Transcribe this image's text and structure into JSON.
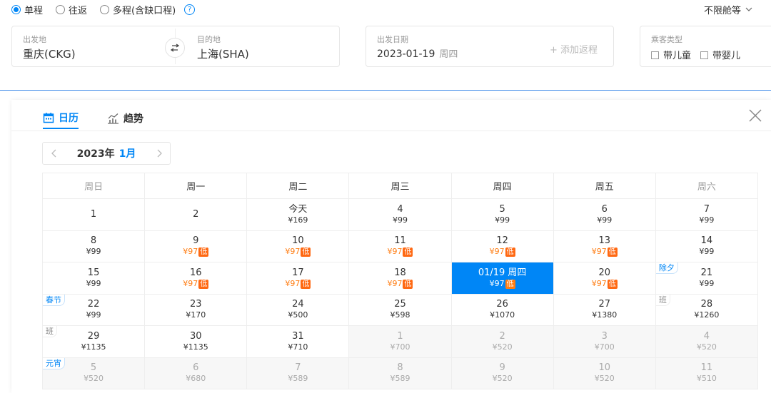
{
  "trip_types": [
    {
      "label": "单程",
      "selected": true
    },
    {
      "label": "往返",
      "selected": false
    },
    {
      "label": "多程(含缺口程)",
      "selected": false
    }
  ],
  "cabin": "不限舱等",
  "departure": {
    "label": "出发地",
    "value": "重庆(CKG)"
  },
  "arrival": {
    "label": "目的地",
    "value": "上海(SHA)"
  },
  "date": {
    "label": "出发日期",
    "value": "2023-01-19",
    "weekday": "周四",
    "add_return": "+ 添加返程"
  },
  "passengers": {
    "label": "乘客类型",
    "child": "带儿童",
    "infant": "带婴儿"
  },
  "tabs": {
    "calendar": "日历",
    "trend": "趋势"
  },
  "month_nav": {
    "year": "2023年",
    "month": "1月"
  },
  "colors": {
    "accent": "#0086f6",
    "low": "#ff6913"
  },
  "calendar": {
    "weekdays": [
      "周日",
      "周一",
      "周二",
      "周三",
      "周四",
      "周五",
      "周六"
    ],
    "weeks": [
      [
        {
          "day": "1",
          "price": ""
        },
        {
          "day": "2",
          "price": ""
        },
        {
          "day": "今天",
          "price": "¥169"
        },
        {
          "day": "4",
          "price": "¥99"
        },
        {
          "day": "5",
          "price": "¥99"
        },
        {
          "day": "6",
          "price": "¥99"
        },
        {
          "day": "7",
          "price": "¥99"
        }
      ],
      [
        {
          "day": "8",
          "price": "¥99"
        },
        {
          "day": "9",
          "price": "¥97",
          "low": "低"
        },
        {
          "day": "10",
          "price": "¥97",
          "low": "低"
        },
        {
          "day": "11",
          "price": "¥97",
          "low": "低"
        },
        {
          "day": "12",
          "price": "¥97",
          "low": "低"
        },
        {
          "day": "13",
          "price": "¥97",
          "low": "低"
        },
        {
          "day": "14",
          "price": "¥99"
        }
      ],
      [
        {
          "day": "15",
          "price": "¥99"
        },
        {
          "day": "16",
          "price": "¥97",
          "low": "低"
        },
        {
          "day": "17",
          "price": "¥97",
          "low": "低"
        },
        {
          "day": "18",
          "price": "¥97",
          "low": "低"
        },
        {
          "day": "01/19 周四",
          "price": "¥97",
          "low": "低",
          "selected": true
        },
        {
          "day": "20",
          "price": "¥97",
          "low": "低"
        },
        {
          "day": "21",
          "price": "¥99",
          "tag": "除夕"
        }
      ],
      [
        {
          "day": "22",
          "price": "¥99",
          "tag": "春节"
        },
        {
          "day": "23",
          "price": "¥170"
        },
        {
          "day": "24",
          "price": "¥500"
        },
        {
          "day": "25",
          "price": "¥598"
        },
        {
          "day": "26",
          "price": "¥1070"
        },
        {
          "day": "27",
          "price": "¥1380"
        },
        {
          "day": "28",
          "price": "¥1260",
          "tag": "班"
        }
      ],
      [
        {
          "day": "29",
          "price": "¥1135",
          "tag": "班"
        },
        {
          "day": "30",
          "price": "¥1135"
        },
        {
          "day": "31",
          "price": "¥710"
        },
        {
          "day": "1",
          "price": "¥700",
          "other": true
        },
        {
          "day": "2",
          "price": "¥520",
          "other": true
        },
        {
          "day": "3",
          "price": "¥700",
          "other": true
        },
        {
          "day": "4",
          "price": "¥520",
          "other": true
        }
      ],
      [
        {
          "day": "5",
          "price": "¥520",
          "tag": "元宵",
          "other": true
        },
        {
          "day": "6",
          "price": "¥680",
          "other": true
        },
        {
          "day": "7",
          "price": "¥589",
          "other": true
        },
        {
          "day": "8",
          "price": "¥589",
          "other": true
        },
        {
          "day": "9",
          "price": "¥520",
          "other": true
        },
        {
          "day": "10",
          "price": "¥520",
          "other": true
        },
        {
          "day": "11",
          "price": "¥510",
          "other": true
        }
      ]
    ]
  }
}
